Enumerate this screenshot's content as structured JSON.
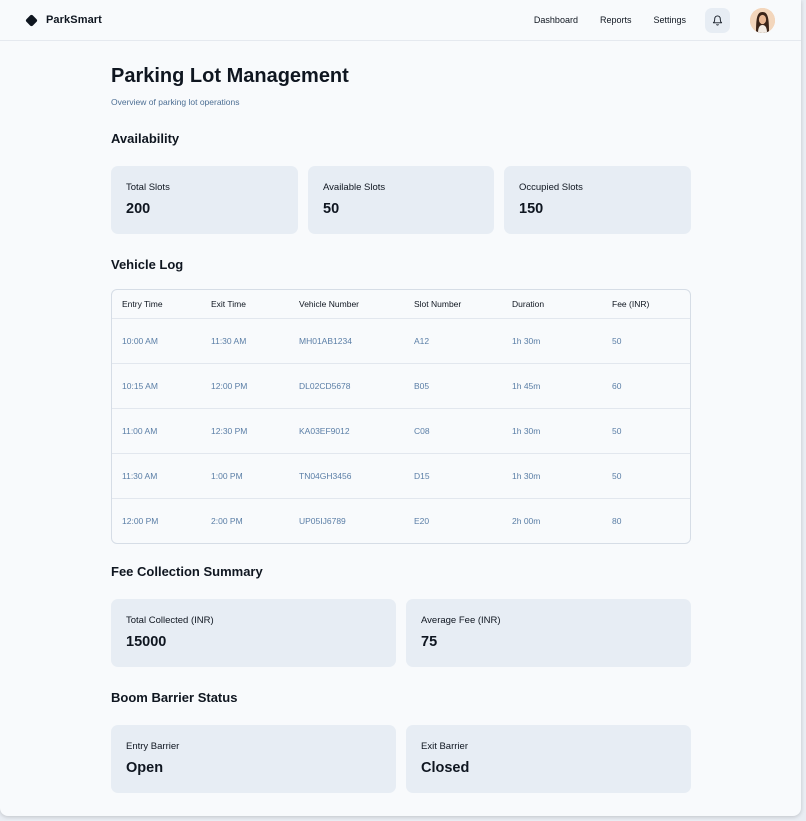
{
  "header": {
    "brand": "ParkSmart",
    "nav": [
      "Dashboard",
      "Reports",
      "Settings"
    ]
  },
  "page": {
    "title": "Parking Lot Management",
    "subtitle": "Overview of parking lot operations"
  },
  "availability": {
    "title": "Availability",
    "cards": [
      {
        "label": "Total Slots",
        "value": "200"
      },
      {
        "label": "Available Slots",
        "value": "50"
      },
      {
        "label": "Occupied Slots",
        "value": "150"
      }
    ]
  },
  "vehicle_log": {
    "title": "Vehicle Log",
    "columns": [
      "Entry Time",
      "Exit Time",
      "Vehicle Number",
      "Slot Number",
      "Duration",
      "Fee (INR)"
    ],
    "rows": [
      [
        "10:00 AM",
        "11:30 AM",
        "MH01AB1234",
        "A12",
        "1h 30m",
        "50"
      ],
      [
        "10:15 AM",
        "12:00 PM",
        "DL02CD5678",
        "B05",
        "1h 45m",
        "60"
      ],
      [
        "11:00 AM",
        "12:30 PM",
        "KA03EF9012",
        "C08",
        "1h 30m",
        "50"
      ],
      [
        "11:30 AM",
        "1:00 PM",
        "TN04GH3456",
        "D15",
        "1h 30m",
        "50"
      ],
      [
        "12:00 PM",
        "2:00 PM",
        "UP05IJ6789",
        "E20",
        "2h 00m",
        "80"
      ]
    ]
  },
  "fees": {
    "title": "Fee Collection Summary",
    "cards": [
      {
        "label": "Total Collected (INR)",
        "value": "15000"
      },
      {
        "label": "Average Fee (INR)",
        "value": "75"
      }
    ]
  },
  "barrier": {
    "title": "Boom Barrier Status",
    "cards": [
      {
        "label": "Entry Barrier",
        "value": "Open"
      },
      {
        "label": "Exit Barrier",
        "value": "Closed"
      }
    ]
  },
  "colors": {
    "accent_text": "#5a7ea6",
    "card_bg": "#e7edf4",
    "page_bg": "#f8fafc"
  },
  "icons": [
    "brand-logo-icon",
    "bell-icon"
  ]
}
